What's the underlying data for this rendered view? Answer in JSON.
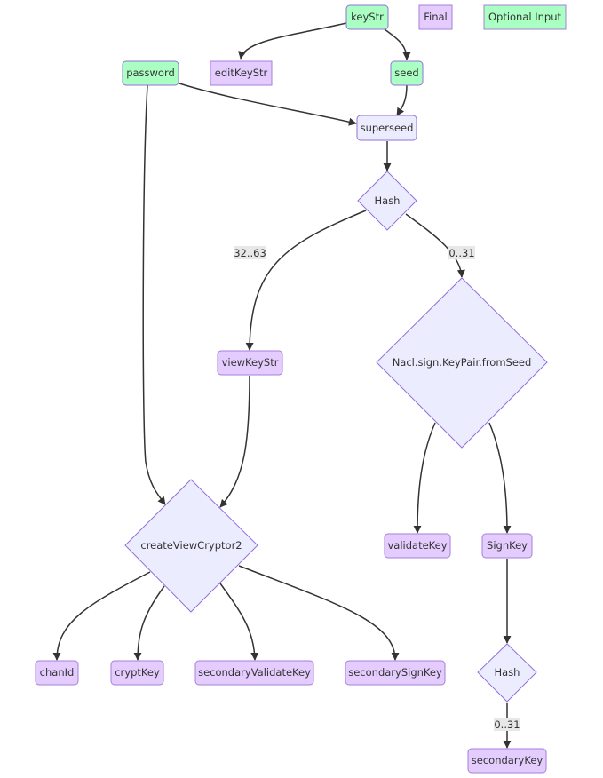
{
  "colors": {
    "optional_fill": "#aaffc3",
    "optional_stroke": "#9370db",
    "final_fill": "#e5ccff",
    "final_stroke": "#a57fd8",
    "default_fill": "#ececff",
    "default_stroke": "#9370db",
    "edge": "#333333",
    "edge_label_bg": "#e8e8e8"
  },
  "legend": {
    "final": "Final",
    "optional_input": "Optional Input"
  },
  "nodes": {
    "keyStr": "keyStr",
    "password": "password",
    "editKeyStr": "editKeyStr",
    "seed": "seed",
    "superseed": "superseed",
    "hash1": "Hash",
    "viewKeyStr": "viewKeyStr",
    "nacl": "Nacl.sign.KeyPair.fromSeed",
    "createViewCryptor2": "createViewCryptor2",
    "validateKey": "validateKey",
    "signKey": "SignKey",
    "chanId": "chanId",
    "cryptKey": "cryptKey",
    "secondaryValidateKey": "secondaryValidateKey",
    "secondarySignKey": "secondarySignKey",
    "hash2": "Hash",
    "secondaryKey": "secondaryKey"
  },
  "edge_labels": {
    "hash1_to_viewKeyStr": "32..63",
    "hash1_to_nacl": "0..31",
    "hash2_to_secondaryKey": "0..31"
  },
  "edges": [
    {
      "from": "keyStr",
      "to": "editKeyStr"
    },
    {
      "from": "keyStr",
      "to": "seed"
    },
    {
      "from": "password",
      "to": "superseed"
    },
    {
      "from": "seed",
      "to": "superseed"
    },
    {
      "from": "superseed",
      "to": "hash1"
    },
    {
      "from": "hash1",
      "to": "viewKeyStr",
      "label": "32..63"
    },
    {
      "from": "hash1",
      "to": "nacl",
      "label": "0..31"
    },
    {
      "from": "password",
      "to": "createViewCryptor2"
    },
    {
      "from": "viewKeyStr",
      "to": "createViewCryptor2"
    },
    {
      "from": "nacl",
      "to": "validateKey"
    },
    {
      "from": "nacl",
      "to": "signKey"
    },
    {
      "from": "createViewCryptor2",
      "to": "chanId"
    },
    {
      "from": "createViewCryptor2",
      "to": "cryptKey"
    },
    {
      "from": "createViewCryptor2",
      "to": "secondaryValidateKey"
    },
    {
      "from": "createViewCryptor2",
      "to": "secondarySignKey"
    },
    {
      "from": "signKey",
      "to": "hash2"
    },
    {
      "from": "hash2",
      "to": "secondaryKey",
      "label": "0..31"
    }
  ]
}
